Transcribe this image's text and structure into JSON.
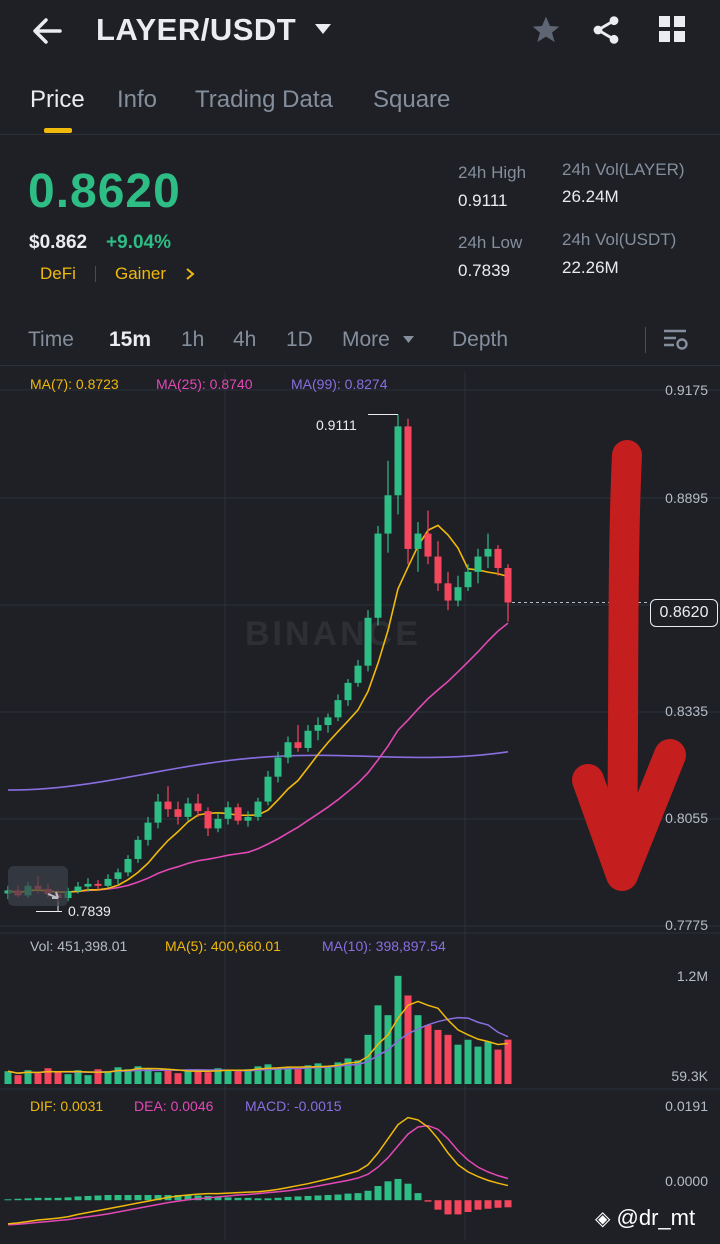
{
  "header": {
    "title": "LAYER/USDT"
  },
  "tabs": [
    "Price",
    "Info",
    "Trading Data",
    "Square"
  ],
  "ticker": {
    "price": "0.8620",
    "usd": "$0.862",
    "change": "+9.04%",
    "tags": [
      "DeFi",
      "Gainer"
    ],
    "high_label": "24h High",
    "high": "0.9111",
    "low_label": "24h Low",
    "low": "0.7839",
    "vol_base_label": "24h Vol(LAYER)",
    "vol_base": "26.24M",
    "vol_quote_label": "24h Vol(USDT)",
    "vol_quote": "22.26M"
  },
  "chart_tabs": [
    "Time",
    "15m",
    "1h",
    "4h",
    "1D",
    "More",
    "Depth"
  ],
  "main_legend": {
    "ma7": "MA(7): 0.8723",
    "ma25": "MA(25): 0.8740",
    "ma99": "MA(99): 0.8274"
  },
  "price_axis": [
    "0.9175",
    "0.8895",
    "0.8620",
    "0.8335",
    "0.8055",
    "0.7775"
  ],
  "high_marker": "0.9111",
  "low_marker": "0.7839",
  "watermark_brand": "BINANCE",
  "vol_legend": {
    "vol": "Vol: 451,398.01",
    "ma5": "MA(5): 400,660.01",
    "ma10": "MA(10): 398,897.54"
  },
  "vol_axis": [
    "1.2M",
    "59.3K"
  ],
  "macd_legend": {
    "dif": "DIF: 0.0031",
    "dea": "DEA: 0.0046",
    "macd": "MACD: -0.0015"
  },
  "macd_axis": [
    "0.0191",
    "0.0000"
  ],
  "credit": "@dr_mt",
  "colors": {
    "up": "#2ebd85",
    "down": "#f6465d",
    "accent": "#f0b90b",
    "ma7": "#f0b90b",
    "ma25": "#e348b5",
    "ma99": "#8a6ee0",
    "annotation": "#c41e1e"
  },
  "chart_data": {
    "type": "candlestick",
    "interval": "15m",
    "ylim": [
      0.7775,
      0.9175
    ],
    "candles": [
      [
        0.786,
        0.788,
        0.7845,
        0.7868
      ],
      [
        0.7868,
        0.788,
        0.785,
        0.7855
      ],
      [
        0.7855,
        0.789,
        0.7848,
        0.788
      ],
      [
        0.788,
        0.7905,
        0.786,
        0.7872
      ],
      [
        0.7872,
        0.7885,
        0.785,
        0.7858
      ],
      [
        0.7858,
        0.787,
        0.7839,
        0.7848
      ],
      [
        0.7848,
        0.7875,
        0.784,
        0.7866
      ],
      [
        0.7866,
        0.789,
        0.786,
        0.7878
      ],
      [
        0.7878,
        0.79,
        0.7865,
        0.7885
      ],
      [
        0.7885,
        0.7895,
        0.787,
        0.788
      ],
      [
        0.788,
        0.791,
        0.7875,
        0.7898
      ],
      [
        0.7898,
        0.7925,
        0.7885,
        0.7915
      ],
      [
        0.7915,
        0.796,
        0.7905,
        0.795
      ],
      [
        0.795,
        0.801,
        0.794,
        0.8
      ],
      [
        0.8,
        0.806,
        0.7985,
        0.8045
      ],
      [
        0.8045,
        0.812,
        0.803,
        0.81
      ],
      [
        0.81,
        0.814,
        0.806,
        0.808
      ],
      [
        0.808,
        0.81,
        0.804,
        0.806
      ],
      [
        0.806,
        0.811,
        0.805,
        0.8095
      ],
      [
        0.8095,
        0.812,
        0.806,
        0.8075
      ],
      [
        0.8075,
        0.8085,
        0.801,
        0.803
      ],
      [
        0.803,
        0.807,
        0.802,
        0.8055
      ],
      [
        0.8055,
        0.81,
        0.804,
        0.8085
      ],
      [
        0.8085,
        0.8095,
        0.804,
        0.805
      ],
      [
        0.805,
        0.8075,
        0.8035,
        0.806
      ],
      [
        0.806,
        0.811,
        0.805,
        0.81
      ],
      [
        0.81,
        0.818,
        0.809,
        0.8165
      ],
      [
        0.8165,
        0.823,
        0.815,
        0.8215
      ],
      [
        0.8215,
        0.827,
        0.82,
        0.8255
      ],
      [
        0.8255,
        0.83,
        0.823,
        0.824
      ],
      [
        0.824,
        0.83,
        0.823,
        0.8285
      ],
      [
        0.8285,
        0.832,
        0.826,
        0.83
      ],
      [
        0.83,
        0.833,
        0.828,
        0.832
      ],
      [
        0.832,
        0.838,
        0.831,
        0.8365
      ],
      [
        0.8365,
        0.842,
        0.835,
        0.841
      ],
      [
        0.841,
        0.847,
        0.84,
        0.8455
      ],
      [
        0.8455,
        0.86,
        0.844,
        0.858
      ],
      [
        0.858,
        0.882,
        0.856,
        0.88
      ],
      [
        0.88,
        0.899,
        0.875,
        0.89
      ],
      [
        0.89,
        0.9111,
        0.885,
        0.908
      ],
      [
        0.908,
        0.91,
        0.872,
        0.876
      ],
      [
        0.876,
        0.883,
        0.87,
        0.88
      ],
      [
        0.88,
        0.886,
        0.872,
        0.874
      ],
      [
        0.874,
        0.878,
        0.865,
        0.867
      ],
      [
        0.867,
        0.87,
        0.86,
        0.8625
      ],
      [
        0.8625,
        0.869,
        0.861,
        0.866
      ],
      [
        0.866,
        0.872,
        0.865,
        0.87
      ],
      [
        0.87,
        0.876,
        0.867,
        0.874
      ],
      [
        0.874,
        0.88,
        0.871,
        0.876
      ],
      [
        0.876,
        0.877,
        0.869,
        0.871
      ],
      [
        0.871,
        0.872,
        0.857,
        0.862
      ]
    ],
    "price_label": "0.8620",
    "volume": {
      "ylim": [
        0,
        1200000
      ],
      "values": [
        130000,
        90000,
        140000,
        110000,
        160000,
        120000,
        100000,
        140000,
        90000,
        150000,
        130000,
        170000,
        150000,
        180000,
        160000,
        120000,
        140000,
        110000,
        130000,
        150000,
        120000,
        160000,
        140000,
        130000,
        150000,
        180000,
        200000,
        160000,
        170000,
        150000,
        190000,
        210000,
        180000,
        220000,
        260000,
        240000,
        500000,
        800000,
        700000,
        1100000,
        900000,
        700000,
        600000,
        550000,
        500000,
        400000,
        450000,
        380000,
        430000,
        350000,
        451398
      ]
    },
    "macd": {
      "ylim": [
        -0.008,
        0.0191
      ],
      "dif": [
        -0.005,
        -0.0048,
        -0.0045,
        -0.0042,
        -0.004,
        -0.0038,
        -0.0035,
        -0.003,
        -0.0026,
        -0.0022,
        -0.0018,
        -0.0014,
        -0.001,
        -0.0006,
        -0.0002,
        0.0002,
        0.0006,
        0.0009,
        0.0011,
        0.0013,
        0.0014,
        0.0014,
        0.0015,
        0.0016,
        0.0017,
        0.0018,
        0.002,
        0.0023,
        0.0027,
        0.0031,
        0.0035,
        0.004,
        0.0045,
        0.005,
        0.0056,
        0.0062,
        0.0075,
        0.01,
        0.013,
        0.016,
        0.0175,
        0.017,
        0.0155,
        0.013,
        0.01,
        0.0075,
        0.006,
        0.005,
        0.0042,
        0.0036,
        0.0031
      ],
      "dea": [
        -0.0052,
        -0.0051,
        -0.0049,
        -0.0047,
        -0.0045,
        -0.0043,
        -0.0041,
        -0.0038,
        -0.0035,
        -0.0032,
        -0.0029,
        -0.0025,
        -0.0021,
        -0.0017,
        -0.0013,
        -0.0009,
        -0.0005,
        -0.0002,
        0.0001,
        0.0003,
        0.0005,
        0.0007,
        0.0009,
        0.0011,
        0.0012,
        0.0014,
        0.0016,
        0.0018,
        0.002,
        0.0023,
        0.0026,
        0.003,
        0.0034,
        0.0038,
        0.0042,
        0.0047,
        0.0055,
        0.007,
        0.009,
        0.0115,
        0.014,
        0.0155,
        0.0158,
        0.015,
        0.013,
        0.0105,
        0.0085,
        0.007,
        0.006,
        0.0052,
        0.0046
      ]
    }
  }
}
